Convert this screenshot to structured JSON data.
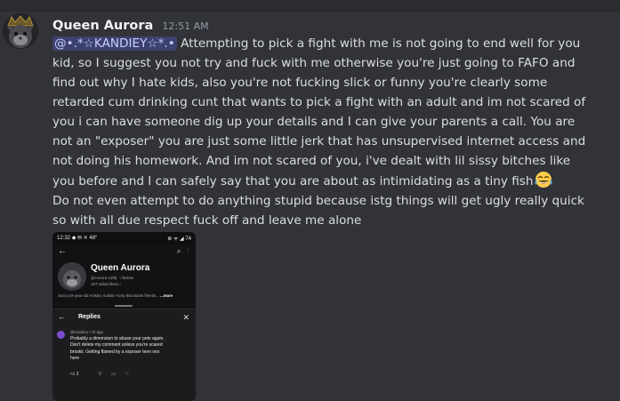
{
  "message": {
    "username": "Queen Aurora",
    "timestamp": "12:51 AM",
    "mention": "@•.*☆KANDIEY☆*.•",
    "paragraph_1": "Attempting to pick a fight with me is not going to end well for you kid, so I suggest you not try and fuck with me otherwise you're just going to FAFO and find out why I hate kids, also you're not fucking slick or funny you're clearly some retarded cum drinking cunt that wants to pick a fight with an adult and im not scared of you i can have someone dig up your details and I can give your parents a call. You are not an \"exposer\" you are just some little jerk that has unsupervised internet access and not doing his homework. And im not scared of you, i've dealt with lil sissy bitches like you before and I can safely say that you are about as intimidating as a tiny fish",
    "emoji": "face-with-tears-of-joy",
    "paragraph_2": "Do not even attempt to do anything stupid because istg things will get ugly really quick so with all due respect fuck off and leave me alone"
  },
  "attachment": {
    "status_time": "12:32",
    "status_left_icons": "◆ ✉ ✕ 48°",
    "status_right": "⊕ ᯤ ◢ 74",
    "channel_name": "Queen Aurora",
    "channel_handle": "@Aurora-x1f9j · ○ba/ow",
    "channel_subs": "107 subscribers ›",
    "channel_desc": "Just a 19-year-old Artistic! Autistic Furry that wants friends... ",
    "channel_desc_more": "...more",
    "replies_title": "Replies",
    "comment_author": "@Kandiey • 1h ago",
    "comment_lines": [
      "Probably a dimension to abuse your pets again.",
      "Don't delete my comment unless you're scared",
      "broskii. Getting flamed by a exposer teen ovo",
      "here"
    ],
    "like_count": "3"
  },
  "colors": {
    "background": "#313338",
    "username": "#f2f3f5",
    "text": "#dbdee1",
    "timestamp": "#949ba4",
    "mention_bg": "#5865f2"
  }
}
